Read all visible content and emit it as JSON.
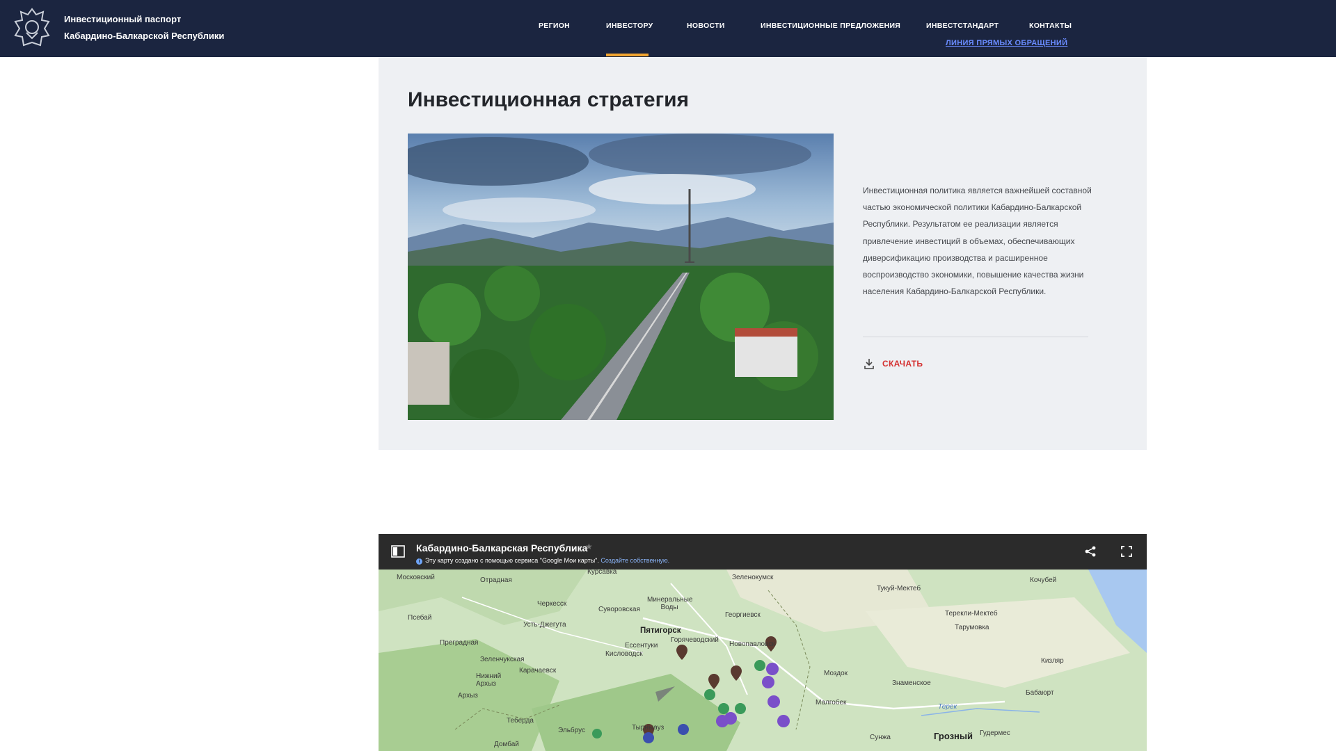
{
  "header": {
    "brand_line1": "Инвестиционный паспорт",
    "brand_line2": "Кабардино-Балкарской Республики",
    "nav": [
      {
        "label": "РЕГИОН"
      },
      {
        "label": "ИНВЕСТОРУ",
        "active": true
      },
      {
        "label": "НОВОСТИ"
      },
      {
        "label": "ИНВЕСТИЦИОННЫЕ ПРЕДЛОЖЕНИЯ"
      },
      {
        "label": "ИНВЕСТСТАНДАРТ"
      },
      {
        "label": "КОНТАКТЫ"
      }
    ],
    "hotline": "ЛИНИЯ ПРЯМЫХ ОБРАЩЕНИЙ",
    "accent_color": "#f2a531",
    "background_color": "#1b2540"
  },
  "strategy": {
    "title": "Инвестиционная стратегия",
    "description": "Инвестиционная политика является важнейшей составной частью экономической политики Кабардино-Балкарской Республики. Результатом ее реализации является привлечение инвестиций в объемах, обеспечивающих диверсификацию производства и расширенное воспроизводство экономики, повышение качества жизни населения Кабардино-Балкарской Республики.",
    "download_label": "СКАЧАТЬ",
    "download_color": "#d43030"
  },
  "map": {
    "title": "Кабардино-Балкарская Республика",
    "info_text": "Эту карту создано с помощью сервиса \"Google Мои карты\".",
    "info_link": "Создайте собственную.",
    "labels": [
      {
        "text": "Московский"
      },
      {
        "text": "Отрадная"
      },
      {
        "text": "Курсавка"
      },
      {
        "text": "Зеленокумск"
      },
      {
        "text": "Тукуй-Мектеб"
      },
      {
        "text": "Кочубей"
      },
      {
        "text": "Черкесск"
      },
      {
        "text": "Суворовская"
      },
      {
        "text": "Минеральные Воды"
      },
      {
        "text": "Георгиевск"
      },
      {
        "text": "Терекли-Мектеб"
      },
      {
        "text": "Псебай"
      },
      {
        "text": "Усть-Джегута"
      },
      {
        "text": "Пятигорск"
      },
      {
        "text": "Горячеводский"
      },
      {
        "text": "Новопавловск"
      },
      {
        "text": "Тарумовка"
      },
      {
        "text": "Ессентуки"
      },
      {
        "text": "Кисловодск"
      },
      {
        "text": "Преградная"
      },
      {
        "text": "Зеленчукская"
      },
      {
        "text": "Карачаевск"
      },
      {
        "text": "Кизляр"
      },
      {
        "text": "Моздок"
      },
      {
        "text": "Нижний Архыз"
      },
      {
        "text": "Знаменское"
      },
      {
        "text": "Бабаюрт"
      },
      {
        "text": "Архыз"
      },
      {
        "text": "Терек"
      },
      {
        "text": "Малгобек"
      },
      {
        "text": "Теберда"
      },
      {
        "text": "Тырныауз"
      },
      {
        "text": "Эльбрус"
      },
      {
        "text": "Сунжа"
      },
      {
        "text": "Грозный"
      },
      {
        "text": "Гудермес"
      },
      {
        "text": "Домбай"
      }
    ]
  }
}
